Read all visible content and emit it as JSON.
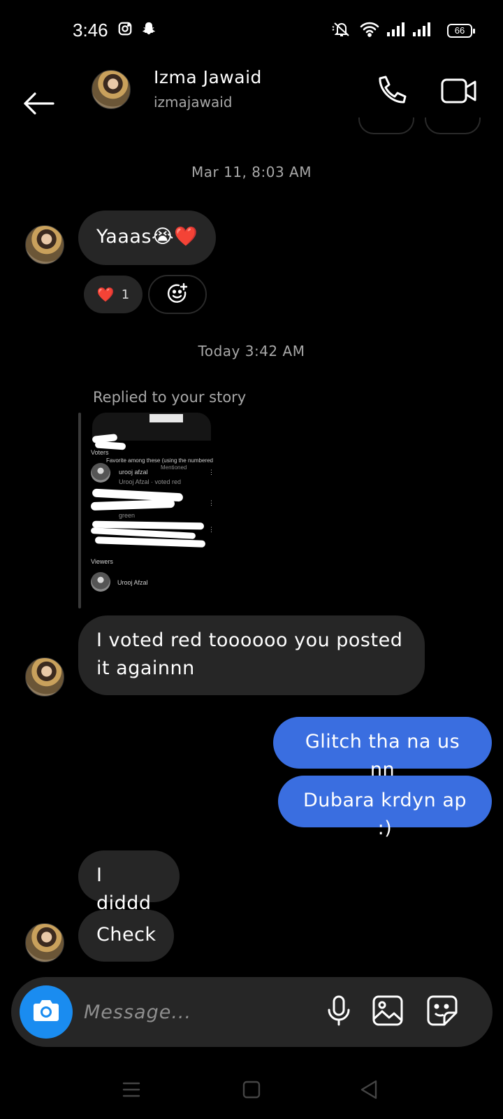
{
  "status_bar": {
    "time": "3:46",
    "battery": "66",
    "icons": [
      "instagram-icon",
      "snapchat-icon",
      "mute-icon",
      "wifi-icon",
      "signal-icon",
      "signal-icon"
    ]
  },
  "header": {
    "name": "Izma Jawaid",
    "username": "izmajawaid",
    "icons": [
      "back-arrow-icon",
      "phone-icon",
      "video-camera-icon"
    ]
  },
  "conversation": {
    "timestamp_1": "Mar 11, 8:03 AM",
    "msg_yaaas": "Yaaas😭❤️",
    "reaction": {
      "emoji": "❤️",
      "count": "1"
    },
    "timestamp_2": "Today 3:42 AM",
    "reply_label": "Replied to your story",
    "story_thumbnail": {
      "voters_label": "Voters",
      "poll_caption": "Favorite among these (using the numbered items)",
      "poll_caption_2": "Mentioned",
      "voter_name": "urooj afzal",
      "voter_sub": "Urooj Afzal · voted red",
      "voter_green": "green",
      "viewers_label": "Viewers",
      "viewer_name": "Urooj Afzal"
    },
    "msg_voted": "I voted red toooooo you posted it againnn",
    "msg_glitch": "Glitch tha na us nn",
    "msg_dubara": "Dubara krdyn ap :)",
    "msg_diddd": "I diddd",
    "msg_check": "Check"
  },
  "composer": {
    "placeholder": "Message...",
    "icons": [
      "camera-icon",
      "microphone-icon",
      "gallery-icon",
      "sticker-icon"
    ]
  },
  "colors": {
    "background": "#000000",
    "incoming_bubble": "#262626",
    "outgoing_bubble": "#3a6ee0",
    "camera_button": "#1a8cf0",
    "muted_text": "#a8a8a8"
  }
}
